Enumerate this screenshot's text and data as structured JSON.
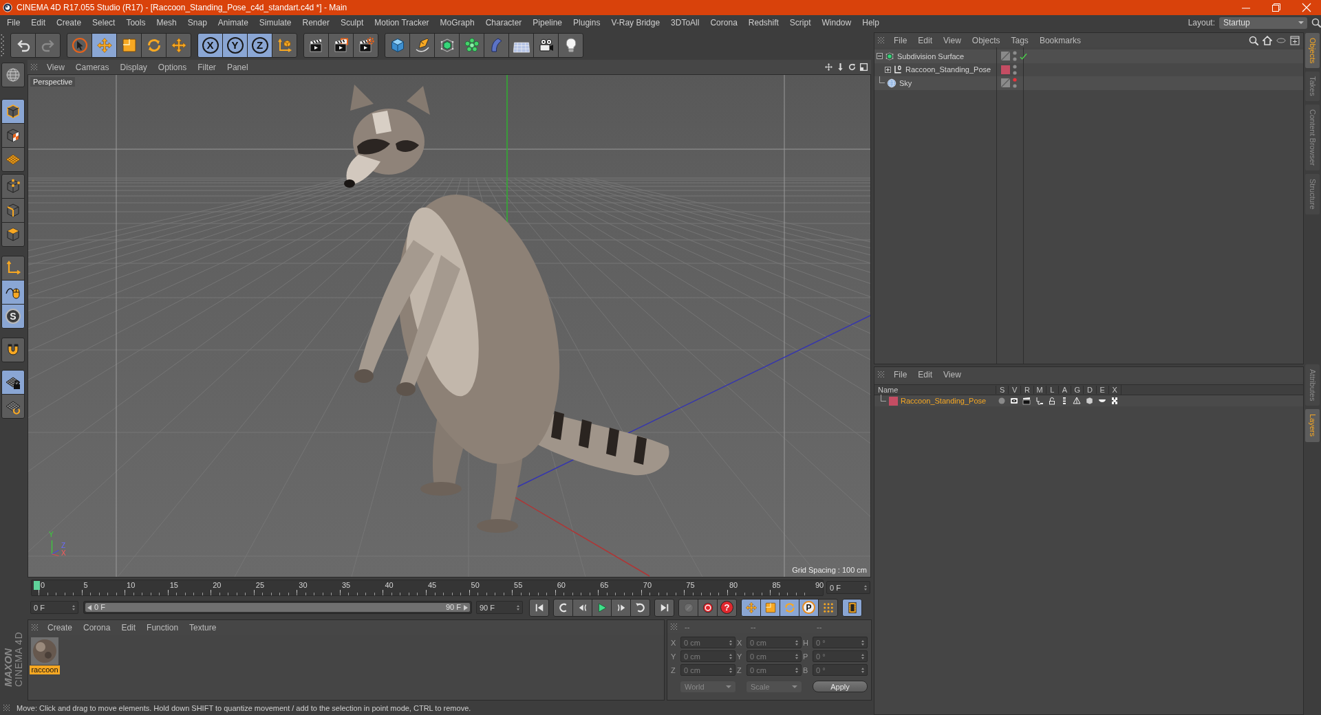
{
  "window": {
    "title": "CINEMA 4D R17.055 Studio (R17) - [Raccoon_Standing_Pose_c4d_standart.c4d *] - Main"
  },
  "menu_bar": {
    "items": [
      "File",
      "Edit",
      "Create",
      "Select",
      "Tools",
      "Mesh",
      "Snap",
      "Animate",
      "Simulate",
      "Render",
      "Sculpt",
      "Motion Tracker",
      "MoGraph",
      "Character",
      "Pipeline",
      "Plugins",
      "V-Ray Bridge",
      "3DToAll",
      "Corona",
      "Redshift",
      "Script",
      "Window",
      "Help"
    ],
    "layout_label": "Layout:",
    "layout_value": "Startup"
  },
  "toolbar": {
    "groups": [
      [
        {
          "kind": "undo",
          "disabled": false
        },
        {
          "kind": "redo",
          "disabled": true
        }
      ],
      [
        {
          "kind": "select",
          "selected": false
        },
        {
          "kind": "move",
          "selected": true
        },
        {
          "kind": "scale",
          "selected": false
        },
        {
          "kind": "rotate",
          "selected": false
        },
        {
          "kind": "transform",
          "selected": false
        }
      ],
      [
        {
          "kind": "axis-lock",
          "label": "X",
          "selected": true
        },
        {
          "kind": "axis-lock",
          "label": "Y",
          "selected": true
        },
        {
          "kind": "axis-lock",
          "label": "Z",
          "selected": true
        },
        {
          "kind": "coordinate-system",
          "selected": false
        }
      ],
      [
        {
          "kind": "render-view"
        },
        {
          "kind": "render-picture"
        },
        {
          "kind": "render-settings"
        }
      ],
      [
        {
          "kind": "cube"
        },
        {
          "kind": "pen"
        },
        {
          "kind": "subdivision"
        },
        {
          "kind": "cloner"
        },
        {
          "kind": "deformer"
        },
        {
          "kind": "floor"
        },
        {
          "kind": "camera"
        },
        {
          "kind": "light"
        }
      ]
    ]
  },
  "modes": {
    "groups": [
      [
        {
          "kind": "make-editable"
        }
      ],
      [
        {
          "kind": "model",
          "selected": true
        },
        {
          "kind": "texture",
          "selected": false
        },
        {
          "kind": "workplane",
          "selected": false
        }
      ],
      [
        {
          "kind": "points",
          "selected": false
        },
        {
          "kind": "edges",
          "selected": false
        },
        {
          "kind": "polygons",
          "selected": false
        }
      ],
      [
        {
          "kind": "axis",
          "selected": false
        },
        {
          "kind": "tweak",
          "selected": true
        },
        {
          "kind": "solo",
          "label": "S",
          "selected": true
        }
      ],
      [
        {
          "kind": "snap",
          "selected": false
        }
      ],
      [
        {
          "kind": "lock-workplane",
          "selected": true
        },
        {
          "kind": "align-workplane",
          "selected": false
        }
      ]
    ]
  },
  "viewport": {
    "menu": [
      "View",
      "Cameras",
      "Display",
      "Options",
      "Filter",
      "Panel"
    ],
    "camera": "Perspective",
    "grid_spacing": "Grid Spacing : 100 cm",
    "axis_labels": [
      "Y",
      "Z",
      "X"
    ]
  },
  "timeline": {
    "labels": [
      "0",
      "5",
      "10",
      "15",
      "20",
      "25",
      "30",
      "35",
      "40",
      "45",
      "50",
      "55",
      "60",
      "65",
      "70",
      "75",
      "80",
      "85",
      "90"
    ],
    "playhead": {
      "level": 0
    },
    "current_frame": "0 F"
  },
  "transport": {
    "start_frame": "0 F",
    "range": {
      "start": "0 F",
      "end": "90 F",
      "level": 1
    },
    "end_frame": "90 F",
    "groups": [
      [
        {
          "kind": "go-to-start"
        }
      ],
      [
        {
          "kind": "previous-key"
        },
        {
          "kind": "previous-frame"
        },
        {
          "kind": "play"
        },
        {
          "kind": "next-frame"
        },
        {
          "kind": "next-key"
        }
      ],
      [
        {
          "kind": "go-to-end"
        }
      ],
      [
        {
          "kind": "record-keys",
          "disabled": true
        },
        {
          "kind": "auto-keyframe",
          "disabled": false
        },
        {
          "kind": "key-selection",
          "label": "?",
          "disabled": false
        }
      ],
      [
        {
          "kind": "key-position",
          "selected": true
        },
        {
          "kind": "key-scale",
          "selected": true
        },
        {
          "kind": "key-rotation",
          "selected": true
        },
        {
          "kind": "key-parameter",
          "label": "P",
          "selected": true
        },
        {
          "kind": "key-point-level",
          "selected": false
        }
      ],
      [
        {
          "kind": "timeline",
          "selected": true
        }
      ]
    ]
  },
  "materials": {
    "menu": [
      "Create",
      "Corona",
      "Edit",
      "Function",
      "Texture"
    ],
    "items": [
      {
        "name": "raccoon",
        "selected": true
      }
    ]
  },
  "coordinates": {
    "headers": [
      "--",
      "--",
      "--"
    ],
    "disabled": true,
    "rows": [
      {
        "position_axis": "X",
        "position": "0 cm",
        "size_axis": "X",
        "size": "0 cm",
        "rotation_axis": "H",
        "rotation": "0 °"
      },
      {
        "position_axis": "Y",
        "position": "0 cm",
        "size_axis": "Y",
        "size": "0 cm",
        "rotation_axis": "P",
        "rotation": "0 °"
      },
      {
        "position_axis": "Z",
        "position": "0 cm",
        "size_axis": "Z",
        "size": "0 cm",
        "rotation_axis": "B",
        "rotation": "0 °"
      }
    ],
    "dropdowns": [
      "World",
      "Scale"
    ],
    "apply": "Apply"
  },
  "status_bar": {
    "text": "Move: Click and drag to move elements. Hold down SHIFT to quantize movement / add to the selection in point mode, CTRL to remove."
  },
  "logo": {
    "brand": "MAXON",
    "product": "CINEMA 4D"
  },
  "objects": {
    "menu": [
      "File",
      "Edit",
      "View",
      "Objects",
      "Tags",
      "Bookmarks"
    ],
    "items": [
      {
        "name": "Subdivision Surface",
        "kind": "subdivision",
        "expanded": true,
        "editor_hidden": false,
        "render_hidden": false,
        "enabled": true,
        "children": [
          {
            "name": "Raccoon_Standing_Pose",
            "kind": "null",
            "expanded": false,
            "color": "#c44d63",
            "editor_hidden": false,
            "render_hidden": false
          }
        ]
      },
      {
        "name": "Sky",
        "kind": "sky",
        "editor_hidden": true,
        "render_hidden": false
      }
    ]
  },
  "layers": {
    "menu": [
      "File",
      "Edit",
      "View"
    ],
    "columns": [
      "Name",
      "S",
      "V",
      "R",
      "M",
      "L",
      "A",
      "G",
      "D",
      "E",
      "X"
    ],
    "items": [
      {
        "name": "Raccoon_Standing_Pose",
        "color": "#c44d63",
        "selected": true
      }
    ]
  },
  "side_tabs": {
    "top": [
      {
        "label": "Objects",
        "selected": true
      },
      {
        "label": "Takes",
        "selected": false
      },
      {
        "label": "Content Browser",
        "selected": false
      },
      {
        "label": "Structure",
        "selected": false
      }
    ],
    "bottom": [
      {
        "label": "Attributes",
        "selected": false
      },
      {
        "label": "Layers",
        "selected": true
      }
    ]
  }
}
